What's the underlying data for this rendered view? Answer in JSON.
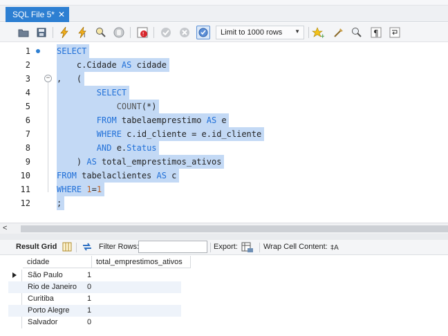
{
  "tab": {
    "title": "SQL File 5*",
    "close": "✕"
  },
  "toolbar": {
    "limit_label": "Limit to 1000 rows",
    "buttons": [
      "open-folder-icon",
      "save-icon",
      "execute-icon",
      "execute-current-icon",
      "explain-icon",
      "stop-icon",
      "toggle-error-icon",
      "commit-icon",
      "rollback-icon",
      "autocommit-icon",
      "bookmark-icon",
      "beautify-icon",
      "find-icon",
      "invisible-chars-icon",
      "wrap-icon"
    ]
  },
  "editor": {
    "lines": [
      {
        "n": "1",
        "segs": [
          {
            "t": "SELECT",
            "c": "kw"
          }
        ]
      },
      {
        "n": "2",
        "segs": [
          {
            "t": "    c.Cidade ",
            "c": ""
          },
          {
            "t": "AS",
            "c": "kw"
          },
          {
            "t": " cidade",
            "c": ""
          }
        ]
      },
      {
        "n": "3",
        "segs": [
          {
            "t": ",   (",
            "c": ""
          }
        ]
      },
      {
        "n": "4",
        "segs": [
          {
            "t": "        ",
            "c": ""
          },
          {
            "t": "SELECT",
            "c": "kw"
          }
        ]
      },
      {
        "n": "5",
        "segs": [
          {
            "t": "            ",
            "c": ""
          },
          {
            "t": "COUNT",
            "c": "fn"
          },
          {
            "t": "(*)",
            "c": ""
          }
        ]
      },
      {
        "n": "6",
        "segs": [
          {
            "t": "        ",
            "c": ""
          },
          {
            "t": "FROM",
            "c": "kw"
          },
          {
            "t": " tabelaemprestimo ",
            "c": ""
          },
          {
            "t": "AS",
            "c": "kw"
          },
          {
            "t": " e",
            "c": ""
          }
        ]
      },
      {
        "n": "7",
        "segs": [
          {
            "t": "        ",
            "c": ""
          },
          {
            "t": "WHERE",
            "c": "kw"
          },
          {
            "t": " c.id_cliente = e.id_cliente",
            "c": ""
          }
        ]
      },
      {
        "n": "8",
        "segs": [
          {
            "t": "        ",
            "c": ""
          },
          {
            "t": "AND",
            "c": "kw"
          },
          {
            "t": " e.",
            "c": ""
          },
          {
            "t": "Status",
            "c": "kw"
          }
        ]
      },
      {
        "n": "9",
        "segs": [
          {
            "t": "    ) ",
            "c": ""
          },
          {
            "t": "AS",
            "c": "kw"
          },
          {
            "t": " total_emprestimos_ativos",
            "c": ""
          }
        ]
      },
      {
        "n": "10",
        "segs": [
          {
            "t": "FROM",
            "c": "kw"
          },
          {
            "t": " tabelaclientes ",
            "c": ""
          },
          {
            "t": "AS",
            "c": "kw"
          },
          {
            "t": " c",
            "c": ""
          }
        ]
      },
      {
        "n": "11",
        "segs": [
          {
            "t": "WHERE",
            "c": "kw"
          },
          {
            "t": " ",
            "c": ""
          },
          {
            "t": "1",
            "c": "num-lit"
          },
          {
            "t": "=",
            "c": ""
          },
          {
            "t": "1",
            "c": "num-lit"
          }
        ]
      },
      {
        "n": "12",
        "segs": [
          {
            "t": ";",
            "c": ""
          }
        ]
      }
    ]
  },
  "results": {
    "result_grid_label": "Result Grid",
    "filter_label": "Filter Rows:",
    "filter_value": "",
    "export_label": "Export:",
    "wrap_label": "Wrap Cell Content:",
    "columns": [
      "cidade",
      "total_emprestimos_ativos"
    ],
    "rows": [
      [
        "São Paulo",
        "1"
      ],
      [
        "Rio de Janeiro",
        "0"
      ],
      [
        "Curitiba",
        "1"
      ],
      [
        "Porto Alegre",
        "1"
      ],
      [
        "Salvador",
        "0"
      ]
    ]
  },
  "colors": {
    "accent": "#2d7fd2",
    "keyword": "#1f6fd8",
    "selection": "#c3d9f5"
  }
}
